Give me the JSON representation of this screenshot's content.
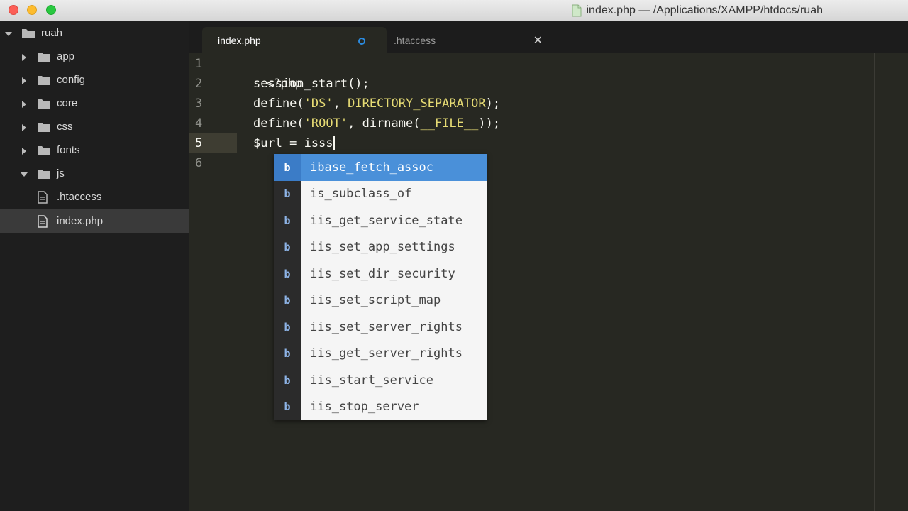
{
  "window": {
    "title": "index.php — /Applications/XAMPP/htdocs/ruah"
  },
  "sidebar": {
    "root": "ruah",
    "items": [
      {
        "label": "app",
        "type": "folder",
        "expanded": false
      },
      {
        "label": "config",
        "type": "folder",
        "expanded": false
      },
      {
        "label": "core",
        "type": "folder",
        "expanded": false
      },
      {
        "label": "css",
        "type": "folder",
        "expanded": false
      },
      {
        "label": "fonts",
        "type": "folder",
        "expanded": false
      },
      {
        "label": "js",
        "type": "folder",
        "expanded": true
      },
      {
        "label": ".htaccess",
        "type": "file"
      },
      {
        "label": "index.php",
        "type": "file",
        "selected": true
      }
    ]
  },
  "tabs": [
    {
      "label": "index.php",
      "active": true,
      "modified": true
    },
    {
      "label": ".htaccess",
      "active": false
    }
  ],
  "editor": {
    "line_numbers": [
      "1",
      "2",
      "3",
      "4",
      "5",
      "6"
    ],
    "current_line": "5",
    "lines": {
      "l1": "<?php",
      "l2_fn": "session_start",
      "l2_rest": "();",
      "l3_fn": "define",
      "l3_open": "(",
      "l3_str": "'DS'",
      "l3_comma": ", ",
      "l3_const": "DIRECTORY_SEPARATOR",
      "l3_close": ");",
      "l4_fn": "define",
      "l4_open": "(",
      "l4_str": "'ROOT'",
      "l4_comma": ", ",
      "l4_fn2": "dirname",
      "l4_open2": "(",
      "l4_const": "__FILE__",
      "l4_close": "));",
      "l5": "$url = isss"
    }
  },
  "autocomplete": {
    "kind": "b",
    "items": [
      "ibase_fetch_assoc",
      "is_subclass_of",
      "iis_get_service_state",
      "iis_set_app_settings",
      "iis_set_dir_security",
      "iis_set_script_map",
      "iis_set_server_rights",
      "iis_get_server_rights",
      "iis_start_service",
      "iis_stop_server"
    ],
    "selected_index": 0
  },
  "colors": {
    "editor_bg": "#272822",
    "sidebar_bg": "#1e1e1e",
    "string": "#e6db74",
    "constant": "#ae81ff",
    "selection": "#4a90d9"
  }
}
